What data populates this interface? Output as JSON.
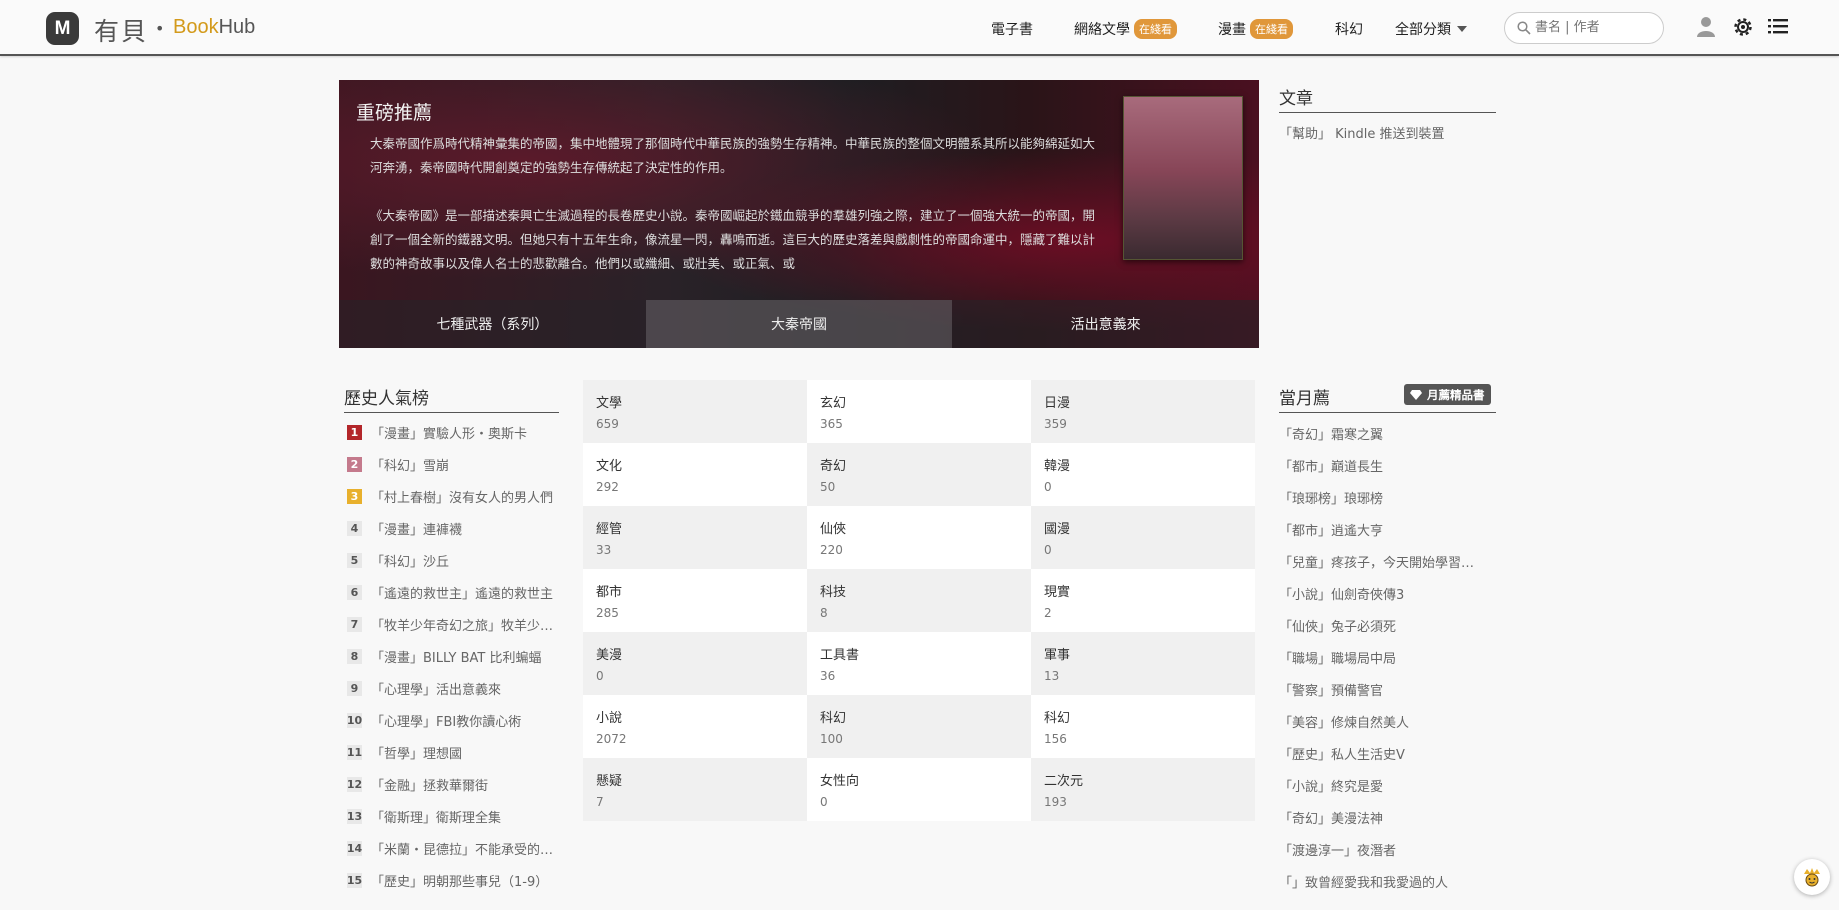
{
  "header": {
    "logo_letter": "M",
    "logo_text": "有貝",
    "logo_dot": "•",
    "brand_book": "Book",
    "brand_hub": "Hub",
    "nav": [
      {
        "label": "電子書",
        "badge": ""
      },
      {
        "label": "網絡文學",
        "badge": "在綫看"
      },
      {
        "label": "漫畫",
        "badge": "在綫看"
      },
      {
        "label": "科幻",
        "badge": ""
      },
      {
        "label": "全部分類",
        "badge": ""
      }
    ],
    "search_placeholder": "書名 | 作者"
  },
  "featured": {
    "title": "重磅推薦",
    "paragraph1": "大秦帝國作爲時代精神彙集的帝國，集中地體現了那個時代中華民族的強勢生存精神。中華民族的整個文明體系其所以能夠綿延如大河奔湧，秦帝國時代開創奠定的強勢生存傳統起了決定性的作用。",
    "paragraph2": "《大秦帝國》是一部描述秦興亡生滅過程的長卷歷史小說。秦帝國崛起於鐵血競爭的羣雄列強之際，建立了一個強大統一的帝國，開創了一個全新的鐵器文明。但她只有十五年生命，像流星一閃，轟鳴而逝。這巨大的歷史落差與戲劇性的帝國命運中，隱藏了難以計數的神奇故事以及偉人名士的悲歡離合。他們以或纖細、或壯美、或正氣、或",
    "tabs": [
      "七種武器（系列）",
      "大秦帝國",
      "活出意義來"
    ],
    "active_tab": 1
  },
  "articles": {
    "title": "文章",
    "items": [
      "「幫助」 Kindle 推送到裝置"
    ]
  },
  "ranking": {
    "title": "歷史人氣榜",
    "colors": [
      "#b3262a",
      "#c47a8c",
      "#e8b02c"
    ],
    "items": [
      {
        "num": "1",
        "text": "「漫畫」實驗人形・奧斯卡"
      },
      {
        "num": "2",
        "text": "「科幻」雪崩"
      },
      {
        "num": "3",
        "text": "「村上春樹」沒有女人的男人們"
      },
      {
        "num": "4",
        "text": "「漫畫」連褲襪"
      },
      {
        "num": "5",
        "text": "「科幻」沙丘"
      },
      {
        "num": "6",
        "text": "「遙遠的救世主」遙遠的救世主"
      },
      {
        "num": "7",
        "text": "「牧羊少年奇幻之旅」牧羊少年奇幻之旅"
      },
      {
        "num": "8",
        "text": "「漫畫」BILLY BAT 比利蝙蝠"
      },
      {
        "num": "9",
        "text": "「心理學」活出意義來"
      },
      {
        "num": "10",
        "text": "「心理學」FBI教你讀心術"
      },
      {
        "num": "11",
        "text": "「哲學」理想國"
      },
      {
        "num": "12",
        "text": "「金融」拯救華爾街"
      },
      {
        "num": "13",
        "text": "「衛斯理」衛斯理全集"
      },
      {
        "num": "14",
        "text": "「米蘭・昆德拉」不能承受的生命之輕"
      },
      {
        "num": "15",
        "text": "「歷史」明朝那些事兒（1-9）"
      }
    ]
  },
  "categories": [
    {
      "name": "文學",
      "count": "659"
    },
    {
      "name": "玄幻",
      "count": "365"
    },
    {
      "name": "日漫",
      "count": "359"
    },
    {
      "name": "文化",
      "count": "292"
    },
    {
      "name": "奇幻",
      "count": "50"
    },
    {
      "name": "韓漫",
      "count": "0"
    },
    {
      "name": "經管",
      "count": "33"
    },
    {
      "name": "仙俠",
      "count": "220"
    },
    {
      "name": "國漫",
      "count": "0"
    },
    {
      "name": "都市",
      "count": "285"
    },
    {
      "name": "科技",
      "count": "8"
    },
    {
      "name": "現實",
      "count": "2"
    },
    {
      "name": "美漫",
      "count": "0"
    },
    {
      "name": "工具書",
      "count": "36"
    },
    {
      "name": "軍事",
      "count": "13"
    },
    {
      "name": "小說",
      "count": "2072"
    },
    {
      "name": "科幻",
      "count": "100"
    },
    {
      "name": "科幻",
      "count": "156"
    },
    {
      "name": "懸疑",
      "count": "7"
    },
    {
      "name": "女性向",
      "count": "0"
    },
    {
      "name": "二次元",
      "count": "193"
    }
  ],
  "monthly": {
    "title": "當月薦",
    "badge": "月薦精品書",
    "items": [
      "「奇幻」霜寒之翼",
      "「都市」巔道長生",
      "「琅琊榜」琅琊榜",
      "「都市」逍遙大亨",
      "「兒童」疼孩子，今天開始學習正面管教",
      "「小說」仙劍奇俠傳3",
      "「仙俠」兔子必須死",
      "「職場」職場局中局",
      "「警察」預備警官",
      "「美容」修煉自然美人",
      "「歷史」私人生活史V",
      "「小說」終究是愛",
      "「奇幻」美漫法神",
      "「渡邊淳一」夜潛者",
      "「」致曾經愛我和我愛過的人"
    ]
  }
}
